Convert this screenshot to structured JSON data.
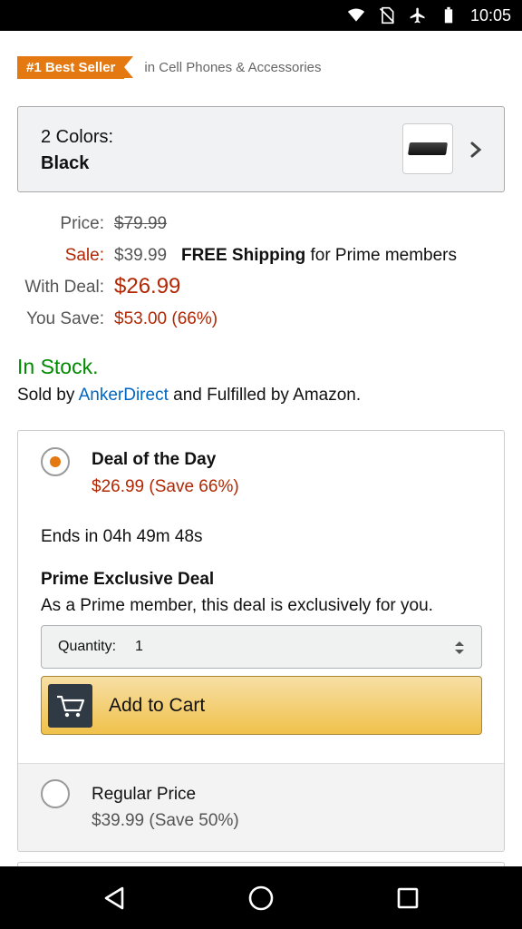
{
  "status_bar": {
    "time": "10:05",
    "icons": [
      "wifi-icon",
      "no-sim-icon",
      "airplane-icon",
      "battery-icon"
    ]
  },
  "best_seller": {
    "badge": "#1 Best Seller",
    "category": "in Cell Phones & Accessories"
  },
  "colors": {
    "count_label": "2 Colors:",
    "selected": "Black"
  },
  "pricing": {
    "price_label": "Price:",
    "price_value": "$79.99",
    "sale_label": "Sale:",
    "sale_value": "$39.99",
    "shipping_bold": "FREE Shipping",
    "shipping_rest": "for Prime members",
    "deal_label": "With Deal:",
    "deal_value": "$26.99",
    "save_label": "You Save:",
    "save_value": "$53.00 (66%)"
  },
  "stock": {
    "status": "In Stock.",
    "sold_by_prefix": "Sold by",
    "seller": "AnkerDirect",
    "fulfilled": "and Fulfilled by Amazon."
  },
  "deal": {
    "title": "Deal of the Day",
    "price": "$26.99 (Save 66%)",
    "ends": "Ends in 04h 49m 48s",
    "prime_title": "Prime Exclusive Deal",
    "prime_desc": "As a Prime member, this deal is exclusively for you.",
    "quantity_label": "Quantity:",
    "quantity_value": "1",
    "add_to_cart": "Add to Cart"
  },
  "regular": {
    "title": "Regular Price",
    "price": "$39.99 (Save 50%)"
  },
  "colors_theme": {
    "accent_orange": "#e47911",
    "price_red": "#b12704",
    "stock_green": "#008a00",
    "link_blue": "#0066c0",
    "cart_yellow": "#f0c14b"
  }
}
